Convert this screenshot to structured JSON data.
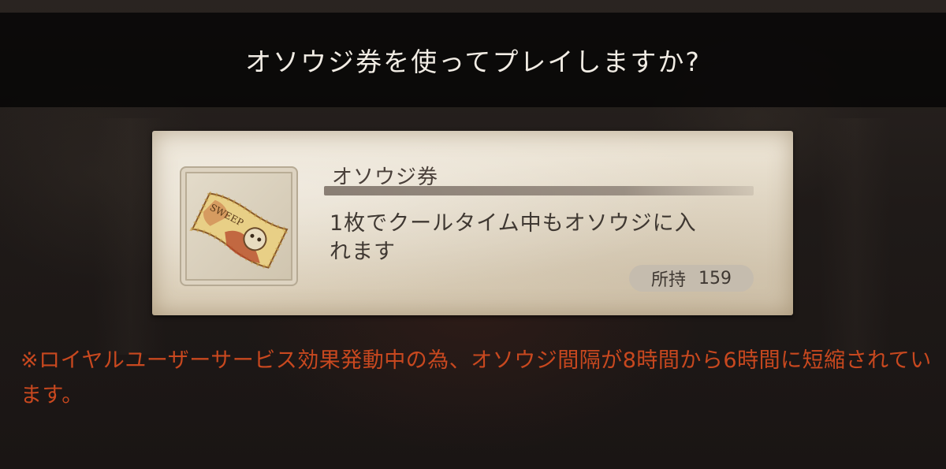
{
  "dialog": {
    "title": "オソウジ券を使ってプレイしますか?"
  },
  "item": {
    "icon": "cleaning-ticket-icon",
    "ticket_text": "SWEEP",
    "name": "オソウジ券",
    "description": "1枚でクールタイム中もオソウジに入れます",
    "owned_label": "所持",
    "owned_count": "159"
  },
  "notice": {
    "text": "※ロイヤルユーザーサービス効果発動中の為、オソウジ間隔が8時間から6時間に短縮されています。"
  },
  "colors": {
    "notice": "#c8481f",
    "card": "#e2d8c5",
    "title_bar": "#080707"
  }
}
